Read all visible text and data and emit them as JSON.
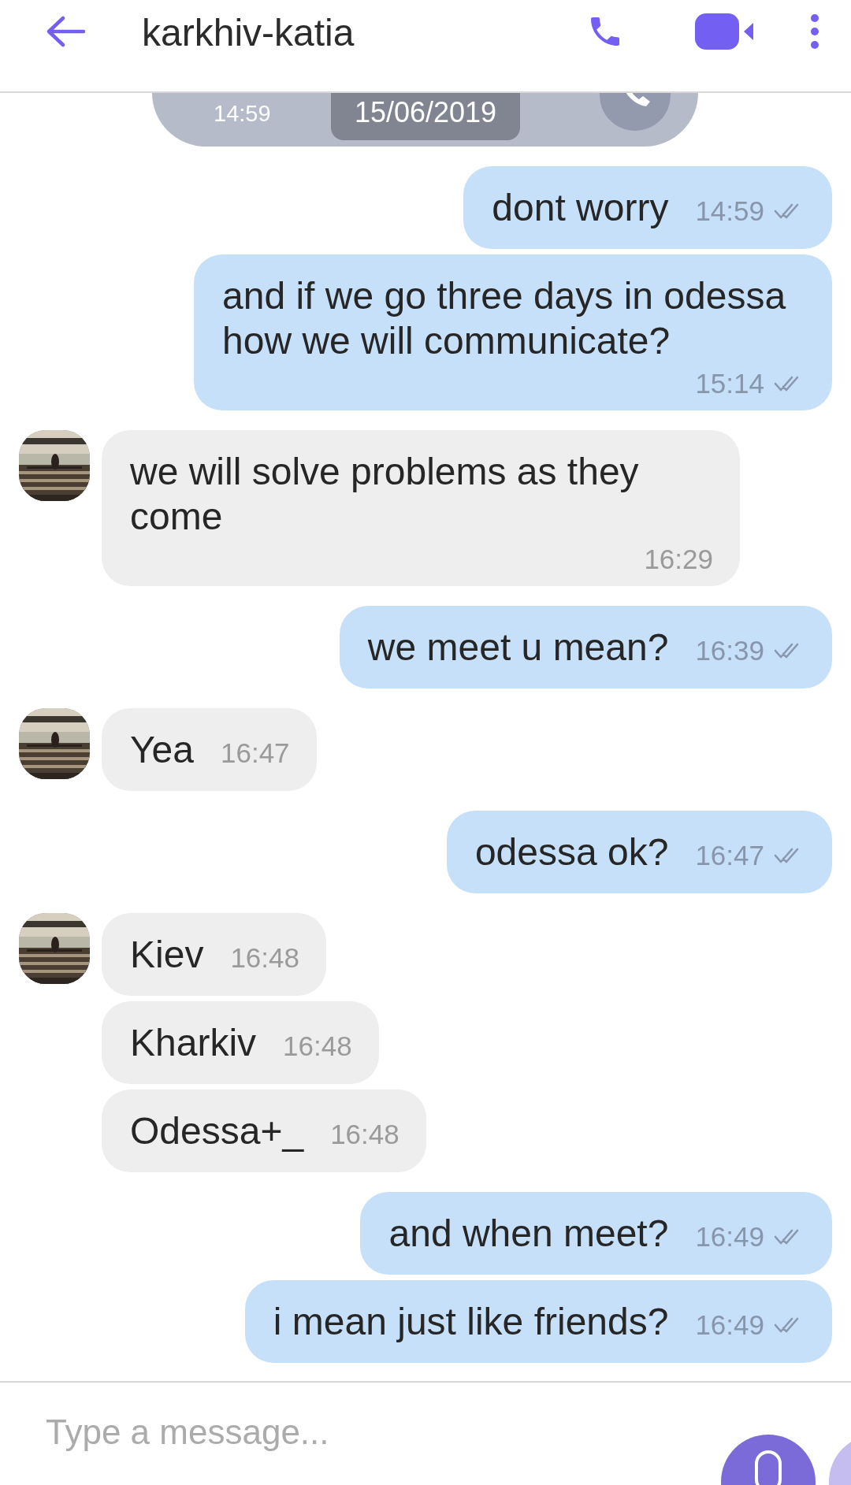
{
  "header": {
    "title": "karkhiv-katia"
  },
  "call_entry": {
    "time": "14:59"
  },
  "date_chip": "15/06/2019",
  "messages": [
    {
      "sent": true,
      "kind": "inline",
      "text": "dont worry",
      "time": "14:59"
    },
    {
      "sent": true,
      "kind": "stacked",
      "text": "and if we go three days in odessa how we will communicate?",
      "time": "15:14"
    },
    {
      "sent": false,
      "kind": "stacked",
      "avatar": true,
      "text": "we will solve problems as they come",
      "time": "16:29"
    },
    {
      "sent": true,
      "kind": "inline",
      "text": "we meet u mean?",
      "time": "16:39"
    },
    {
      "sent": false,
      "kind": "inline",
      "avatar": true,
      "text": "Yea",
      "time": "16:47"
    },
    {
      "sent": true,
      "kind": "inline",
      "text": "odessa ok?",
      "time": "16:47"
    },
    {
      "sent": false,
      "kind": "inline",
      "avatar": true,
      "text": "Kiev",
      "time": "16:48"
    },
    {
      "sent": false,
      "kind": "inline",
      "avatar": false,
      "text": "Kharkiv",
      "time": "16:48"
    },
    {
      "sent": false,
      "kind": "inline",
      "avatar": false,
      "text": "Odessa+_",
      "time": "16:48"
    },
    {
      "sent": true,
      "kind": "inline",
      "text": "and when meet?",
      "time": "16:49"
    },
    {
      "sent": true,
      "kind": "inline",
      "text": "i mean just like friends?",
      "time": "16:49"
    }
  ],
  "composer": {
    "placeholder": "Type a message..."
  }
}
